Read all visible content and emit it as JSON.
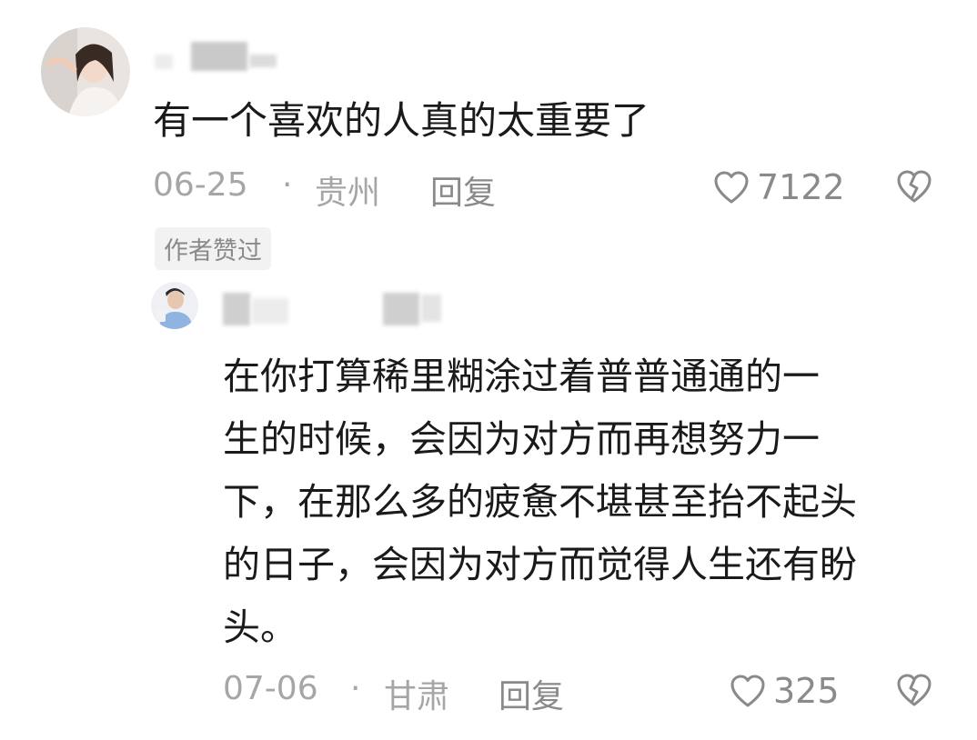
{
  "comment": {
    "text": "有一个喜欢的人真的太重要了",
    "date": "06-25",
    "separator": "·",
    "location": "贵州",
    "reply_label": "回复",
    "likes": "7122",
    "author_badge": "作者赞过"
  },
  "reply": {
    "lines": [
      "在你打算稀里糊涂过着普普通通的一",
      "生的时候，会因为对方而再想努力一",
      "下，在那么多的疲惫不堪甚至抬不起头",
      "的日子，会因为对方而觉得人生还有盼",
      "头。"
    ],
    "date": "07-06",
    "separator": "·",
    "location": "甘肃",
    "reply_label": "回复",
    "likes": "325"
  },
  "icons": {
    "like": "heart-outline-icon",
    "dislike": "broken-heart-icon"
  },
  "colors": {
    "text": "#1a1a1a",
    "meta": "#a6a6a6",
    "action": "#8a8a8a",
    "badge_bg": "#f2f2f2"
  }
}
